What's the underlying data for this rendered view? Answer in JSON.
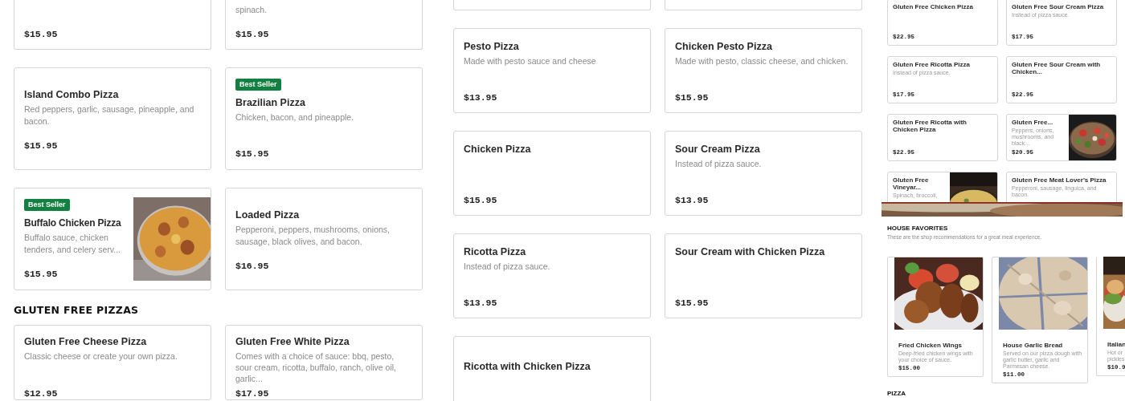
{
  "left_column": {
    "cards": [
      {
        "kind": "cut",
        "price": "$15.95",
        "photo": false
      },
      {
        "kind": "cut",
        "description": "spinach.",
        "price": "$15.95",
        "photo": false
      },
      {
        "kind": "item",
        "name": "Island Combo Pizza",
        "description": "Red peppers, garlic, sausage, pineapple, and bacon.",
        "price": "$15.95",
        "photo": false
      },
      {
        "kind": "item",
        "badge": "Best Seller",
        "name": "Brazilian Pizza",
        "description": "Chicken, bacon, and pineapple.",
        "price": "$15.95",
        "photo": false
      },
      {
        "kind": "item",
        "badge": "Best Seller",
        "name": "Buffalo Chicken Pizza",
        "description": "Buffalo sauce, chicken tenders, and celery serv...",
        "price": "$15.95",
        "photo": true
      },
      {
        "kind": "item",
        "name": "Loaded Pizza",
        "description": "Pepperoni, peppers, mushrooms, onions, sausage, black olives, and bacon.",
        "price": "$16.95",
        "photo": false
      }
    ],
    "heading": "GLUTEN FREE PIZZAS",
    "gluten_free_cards": [
      {
        "kind": "item",
        "name": "Gluten Free Cheese Pizza",
        "description": "Classic cheese or create your own pizza.",
        "price": "$12.95",
        "photo": false
      },
      {
        "kind": "item",
        "name": "Gluten Free White Pizza",
        "description": "Comes with a choice of sauce: bbq, pesto, sour cream, ricotta, buffalo, ranch, olive oil, garlic...",
        "price": "$17.95",
        "photo": false
      }
    ]
  },
  "middle_column": {
    "cards": [
      {
        "kind": "cut",
        "photo": false
      },
      {
        "kind": "cut",
        "photo": false
      },
      {
        "kind": "item",
        "name": "Pesto Pizza",
        "description": "Made with pesto sauce and cheese",
        "price": "$13.95",
        "photo": false
      },
      {
        "kind": "item",
        "name": "Chicken Pesto Pizza",
        "description": "Made with pesto, classic cheese, and chicken.",
        "price": "$15.95",
        "photo": false
      },
      {
        "kind": "item",
        "name": "Chicken Pizza",
        "price": "$15.95",
        "photo": false
      },
      {
        "kind": "item",
        "name": "Sour Cream Pizza",
        "description": "Instead of pizza sauce.",
        "price": "$13.95",
        "photo": false
      },
      {
        "kind": "item",
        "name": "Ricotta Pizza",
        "description": "Instead of pizza sauce.",
        "price": "$13.95",
        "photo": false
      },
      {
        "kind": "item",
        "name": "Sour Cream with Chicken Pizza",
        "price": "$15.95",
        "photo": false
      },
      {
        "kind": "item",
        "name": "Ricotta with Chicken Pizza",
        "photo": false
      }
    ]
  },
  "right_column": {
    "cards": [
      {
        "kind": "item",
        "name": "Gluten Free Chicken Pizza",
        "price": "$22.95",
        "photo": false
      },
      {
        "kind": "item",
        "name": "Gluten Free Sour Cream Pizza",
        "description": "Instead of pizza sauce.",
        "price": "$17.95",
        "photo": false
      },
      {
        "kind": "item",
        "name": "Gluten Free Ricotta Pizza",
        "description": "Instead of pizza sauce.",
        "price": "$17.95",
        "photo": false
      },
      {
        "kind": "item",
        "name": "Gluten Free Sour Cream with Chicken...",
        "price": "$22.95",
        "photo": false
      },
      {
        "kind": "item",
        "name": "Gluten Free Ricotta with Chicken Pizza",
        "price": "$22.95",
        "photo": false
      },
      {
        "kind": "item",
        "name": "Gluten Free...",
        "description": "Peppers, onions, mushrooms, and black...",
        "price": "$20.95",
        "photo": true
      },
      {
        "kind": "item",
        "name": "Gluten Free Vineyar...",
        "description": "Spinach, broccoli,",
        "photo": true
      },
      {
        "kind": "item",
        "name": "Gluten Free Meat Lover's Pizza",
        "description": "Pepperoni, sausage, linguica, and bacon.",
        "photo": false
      }
    ],
    "house_favorites": {
      "title": "HOUSE FAVORITES",
      "subtitle": "These are the shop recommendations for a great meal experience.",
      "cards": [
        {
          "kind": "item",
          "name": "Fried Chicken Wings",
          "description": "Deep-fried chicken wings with your choice of sauce.",
          "price": "$15.00",
          "photo": true
        },
        {
          "kind": "item",
          "name": "House Garlic Bread",
          "description": "Served on our pizza dough with garlic butter, garlic and Parmesan cheese.",
          "price": "$11.00",
          "photo": true
        },
        {
          "kind": "cut",
          "name": "Italian",
          "description": "Hot or pickles,",
          "price": "$10.9",
          "photo": true
        }
      ]
    },
    "next_heading": "PIZZA"
  }
}
